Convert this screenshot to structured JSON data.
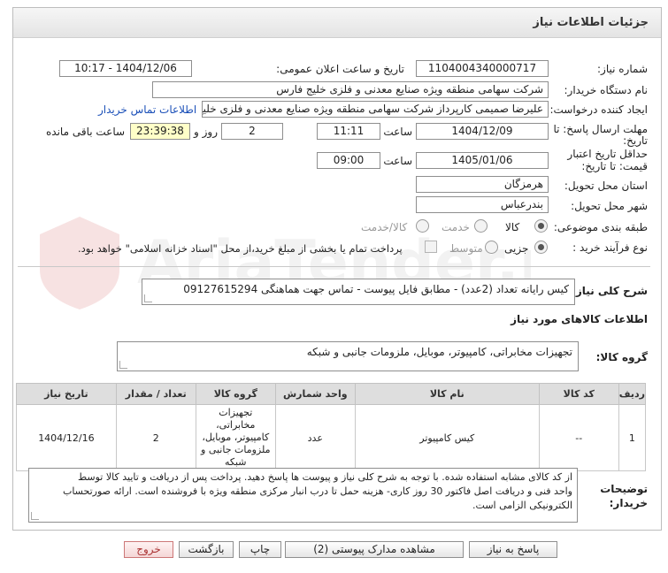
{
  "header": {
    "title": "جزئیات اطلاعات نیاز"
  },
  "fields": {
    "need_number_label": "شماره نیاز:",
    "need_number": "1104004340000717",
    "announce_label": "تاریخ و ساعت اعلان عمومی:",
    "announce_value": "1404/12/06 - 10:17",
    "buyer_label": "نام دستگاه خریدار:",
    "buyer_value": "شرکت سهامی منطقه ویژه صنایع معدنی و فلزی خلیج فارس",
    "creator_label": "ایجاد کننده درخواست:",
    "creator_value": "علیرضا صمیمی کارپرداز شرکت سهامی منطقه ویژه صنایع معدنی و فلزی خلیج ف",
    "contact_link": "اطلاعات تماس خریدار",
    "deadline_label_1": "مهلت ارسال پاسخ: تا",
    "deadline_label_2": "تاریخ:",
    "deadline_date": "1404/12/09",
    "time_label": "ساعت",
    "deadline_time": "11:11",
    "days_value": "2",
    "days_label": "روز و",
    "remaining_value": "23:39:38",
    "remaining_label": "ساعت باقی مانده",
    "validity_label_1": "حداقل تاریخ اعتبار",
    "validity_label_2": "قیمت: تا تاریخ:",
    "validity_date": "1405/01/06",
    "validity_time": "09:00",
    "province_label": "استان محل تحویل:",
    "province_value": "هرمزگان",
    "city_label": "شهر محل تحویل:",
    "city_value": "بندرعباس",
    "category_label": "طبقه بندی موضوعی:",
    "cat_goods": "کالا",
    "cat_service": "خدمت",
    "cat_goods_service": "کالا/خدمت",
    "process_label": "نوع فرآیند خرید :",
    "proc_partial": "جزیی",
    "proc_medium": "متوسط",
    "payment_note": "پرداخت تمام یا بخشی از مبلغ خرید،از محل \"اسناد خزانه اسلامی\" خواهد بود."
  },
  "summary": {
    "label": "شرح کلی نیاز:",
    "value": "کیس رایانه تعداد (2عدد) - مطابق فایل پیوست - تماس جهت هماهنگی 09127615294"
  },
  "goods_info": {
    "title": "اطلاعات کالاهای مورد نیاز",
    "group_label": "گروه کالا:",
    "group_value": "تجهیزات مخابراتی، کامپیوتر، موبایل، ملزومات جانبی و شبکه"
  },
  "table": {
    "headers": [
      "ردیف",
      "کد کالا",
      "نام کالا",
      "واحد شمارش",
      "گروه کالا",
      "تعداد / مقدار",
      "تاریخ نیاز"
    ],
    "rows": [
      {
        "row": "1",
        "code": "--",
        "name": "کیس کامپیوتر",
        "unit": "عدد",
        "group_lines": [
          "تجهیزات مخابراتی،",
          "کامپیوتر، موبایل،",
          "ملزومات جانبی و",
          "شبکه"
        ],
        "qty": "2",
        "date": "1404/12/16"
      }
    ]
  },
  "notes": {
    "label_1": "توضیحات",
    "label_2": "خریدار:",
    "lines": [
      "از کد کالای مشابه استفاده شده. با توجه به شرح کلی نیاز و پیوست ها پاسخ دهید. پرداخت پس از دریافت و تایید کالا توسط",
      "واحد فنی و دریافت اصل فاکتور 30 روز کاری- هزینه حمل تا درب انبار مرکزی منطقه ویژه با فروشنده است. ارائه صورتحساب",
      "الکترونیکی الزامی است."
    ]
  },
  "buttons": {
    "reply": "پاسخ به نیاز",
    "attachments": "مشاهده مدارک پیوستی (2)",
    "print": "چاپ",
    "back": "بازگشت",
    "exit": "خروج"
  },
  "watermark": {
    "text": "AriaTender.neT"
  },
  "colors": {
    "highlight": "#ffffc8",
    "link": "#1a4fb8",
    "header_bg": "#e4e4e4",
    "exit_red": "#a33333"
  }
}
